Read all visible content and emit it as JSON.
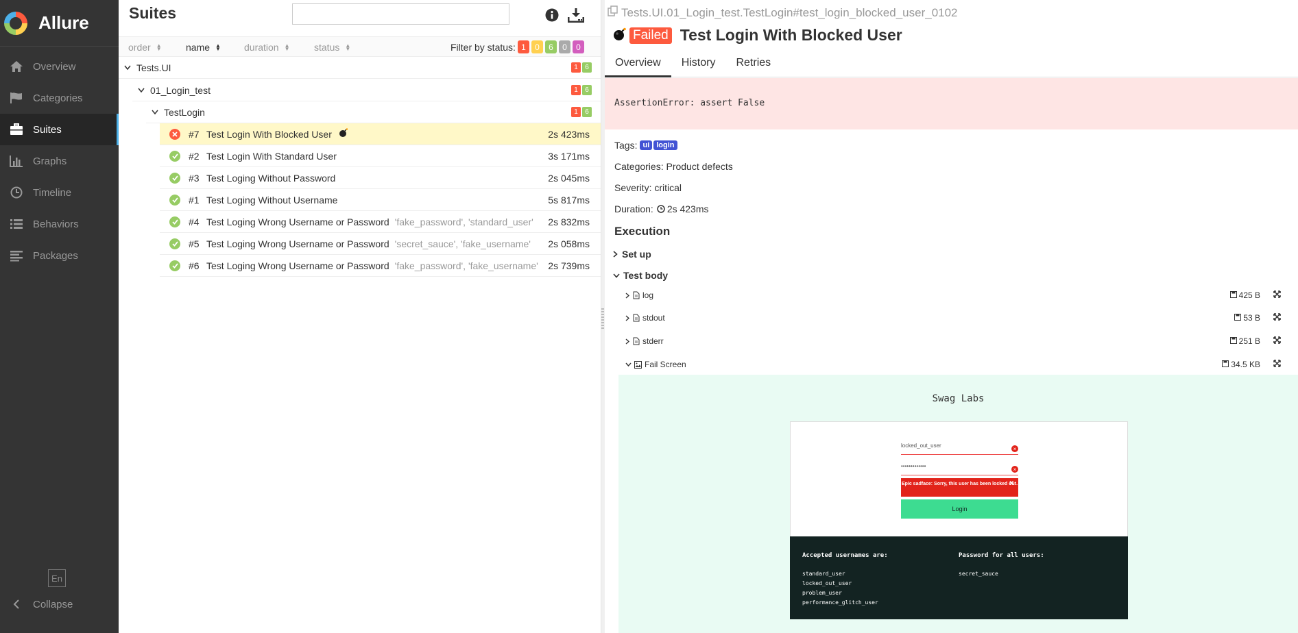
{
  "sidebar": {
    "brand": "Allure",
    "items": [
      {
        "label": "Overview",
        "icon": "home-icon"
      },
      {
        "label": "Categories",
        "icon": "flag-icon"
      },
      {
        "label": "Suites",
        "icon": "briefcase-icon"
      },
      {
        "label": "Graphs",
        "icon": "bar-chart-icon"
      },
      {
        "label": "Timeline",
        "icon": "clock-icon"
      },
      {
        "label": "Behaviors",
        "icon": "list-icon"
      },
      {
        "label": "Packages",
        "icon": "align-left-icon"
      }
    ],
    "active": "Suites",
    "language": "En",
    "collapse_label": "Collapse"
  },
  "suites": {
    "title": "Suites",
    "search_value": "",
    "sort": {
      "order": "order",
      "name": "name",
      "duration": "duration",
      "status": "status",
      "active": "name"
    },
    "filter_label": "Filter by status:",
    "status_counts": {
      "failed": "1",
      "broken": "0",
      "passed": "6",
      "skipped": "0",
      "unknown": "0"
    },
    "tree": [
      {
        "label": "Tests.UI",
        "failed": "1",
        "passed": "6"
      },
      {
        "label": "01_Login_test",
        "failed": "1",
        "passed": "6"
      },
      {
        "label": "TestLogin",
        "failed": "1",
        "passed": "6"
      }
    ],
    "tests": [
      {
        "num": "#7",
        "name": "Test Login With Blocked User",
        "params": "",
        "duration": "2s 423ms",
        "status": "failed",
        "flaky": true,
        "selected": true
      },
      {
        "num": "#2",
        "name": "Test Login With Standard User",
        "params": "",
        "duration": "3s 171ms",
        "status": "passed"
      },
      {
        "num": "#3",
        "name": "Test Loging Without Password",
        "params": "",
        "duration": "2s 045ms",
        "status": "passed"
      },
      {
        "num": "#1",
        "name": "Test Loging Without Username",
        "params": "",
        "duration": "5s 817ms",
        "status": "passed"
      },
      {
        "num": "#4",
        "name": "Test Loging Wrong Username or Password",
        "params": "'fake_password', 'standard_user'",
        "duration": "2s 832ms",
        "status": "passed"
      },
      {
        "num": "#5",
        "name": "Test Loging Wrong Username or Password",
        "params": "'secret_sauce', 'fake_username'",
        "duration": "2s 058ms",
        "status": "passed"
      },
      {
        "num": "#6",
        "name": "Test Loging Wrong Username or Password",
        "params": "'fake_password', 'fake_username'",
        "duration": "2s 739ms",
        "status": "passed"
      }
    ]
  },
  "detail": {
    "breadcrumb": "Tests.UI.01_Login_test.TestLogin#test_login_blocked_user_0102",
    "status_label": "Failed",
    "title": "Test Login With Blocked User",
    "tabs": [
      "Overview",
      "History",
      "Retries"
    ],
    "active_tab": "Overview",
    "error_message": "AssertionError: assert False",
    "tags_label": "Tags:",
    "tags": [
      "ui",
      "login"
    ],
    "categories": "Categories: Product defects",
    "severity": "Severity: critical",
    "duration_label": "Duration:",
    "duration": "2s 423ms",
    "execution_title": "Execution",
    "setup_label": "Set up",
    "test_body_label": "Test body",
    "attachments": [
      {
        "name": "log",
        "size": "425 B",
        "icon": "file-text-icon"
      },
      {
        "name": "stdout",
        "size": "53 B",
        "icon": "file-text-icon"
      },
      {
        "name": "stderr",
        "size": "251 B",
        "icon": "file-text-icon"
      },
      {
        "name": "Fail Screen",
        "size": "34.5 KB",
        "icon": "image-icon"
      }
    ],
    "screenshot": {
      "app_title": "Swag Labs",
      "username_value": "locked_out_user",
      "password_value": "•••••••••••••",
      "error_text": "Epic sadface: Sorry, this user has been locked out.",
      "login_button": "Login",
      "accepted_heading": "Accepted usernames are:",
      "usernames": [
        "standard_user",
        "locked_out_user",
        "problem_user",
        "performance_glitch_user"
      ],
      "password_heading": "Password for all users:",
      "password": "secret_sauce"
    }
  },
  "colors": {
    "failed": "#fd5a3e",
    "broken": "#ffd050",
    "passed": "#97cc64",
    "skipped": "#aaaaaa",
    "unknown": "#d35ebe",
    "sidebar_bg": "#343434",
    "selected_row": "#fff8c8",
    "error_bg": "#fee5e4",
    "tag": "#4253d4",
    "accent": "#4cb0e8"
  }
}
